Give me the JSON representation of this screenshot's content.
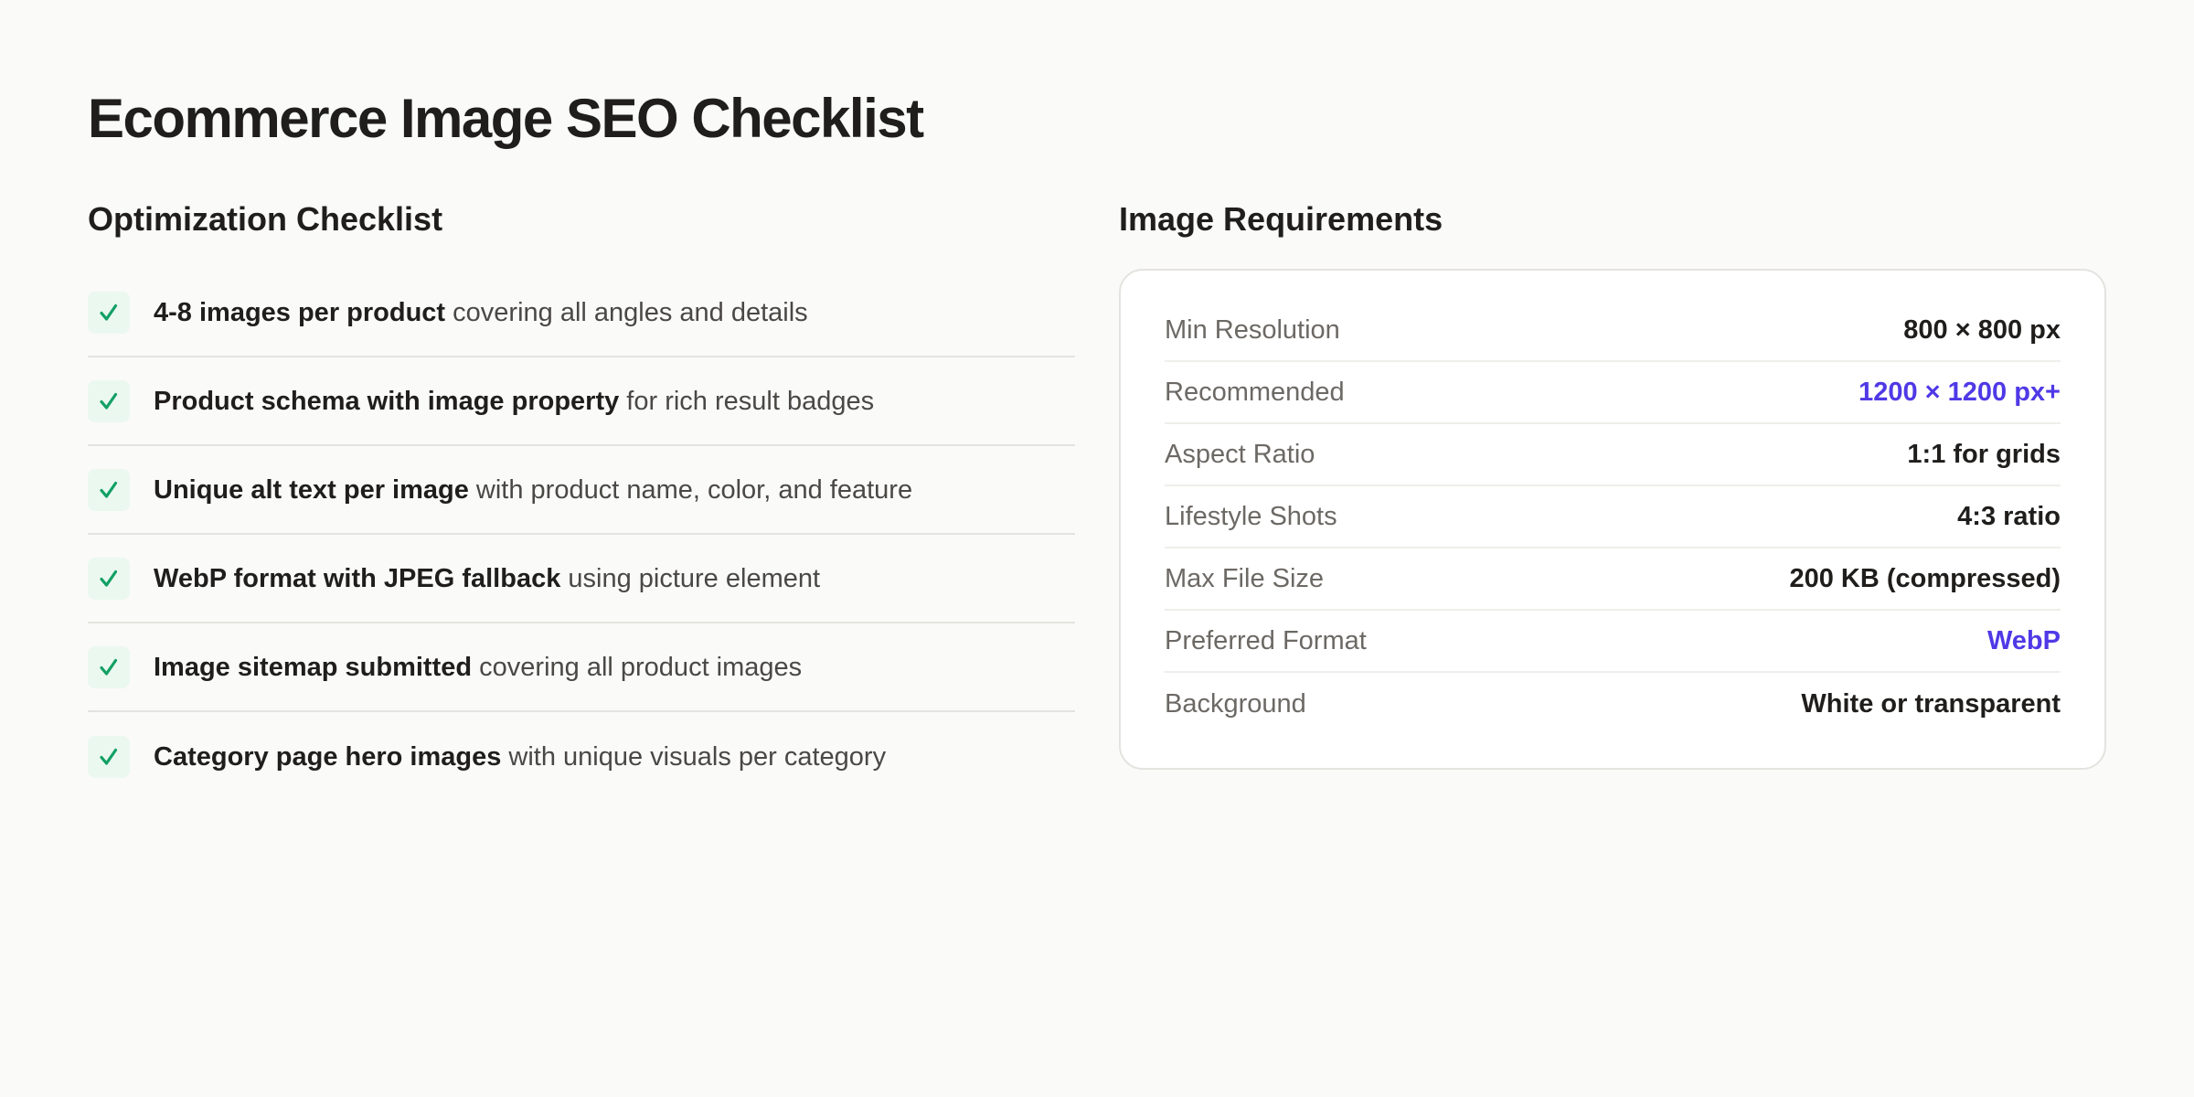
{
  "title": "Ecommerce Image SEO Checklist",
  "checklist": {
    "heading": "Optimization Checklist",
    "items": [
      {
        "strong": "4-8 images per product",
        "rest": " covering all angles and details"
      },
      {
        "strong": "Product schema with image property",
        "rest": " for rich result badges"
      },
      {
        "strong": "Unique alt text per image",
        "rest": " with product name, color, and feature"
      },
      {
        "strong": "WebP format with JPEG fallback",
        "rest": " using picture element"
      },
      {
        "strong": "Image sitemap submitted",
        "rest": " covering all product images"
      },
      {
        "strong": "Category page hero images",
        "rest": " with unique visuals per category"
      }
    ]
  },
  "requirements": {
    "heading": "Image Requirements",
    "rows": [
      {
        "label": "Min Resolution",
        "value": "800 × 800 px"
      },
      {
        "label": "Recommended",
        "value": "1200 × 1200 px+"
      },
      {
        "label": "Aspect Ratio",
        "value": "1:1 for grids"
      },
      {
        "label": "Lifestyle Shots",
        "value": "4:3 ratio"
      },
      {
        "label": "Max File Size",
        "value": "200 KB (compressed)"
      },
      {
        "label": "Preferred Format",
        "value": "WebP"
      },
      {
        "label": "Background",
        "value": "White or transparent"
      }
    ]
  },
  "icons": {
    "check": "check-icon"
  },
  "colors": {
    "background": "#fafaf8",
    "text": "#1f1e1c",
    "muted": "#6c6965",
    "check_green": "#12a064",
    "check_bg": "#ebf8f0",
    "accent": "#4f39e6",
    "border": "#e4e3df"
  }
}
